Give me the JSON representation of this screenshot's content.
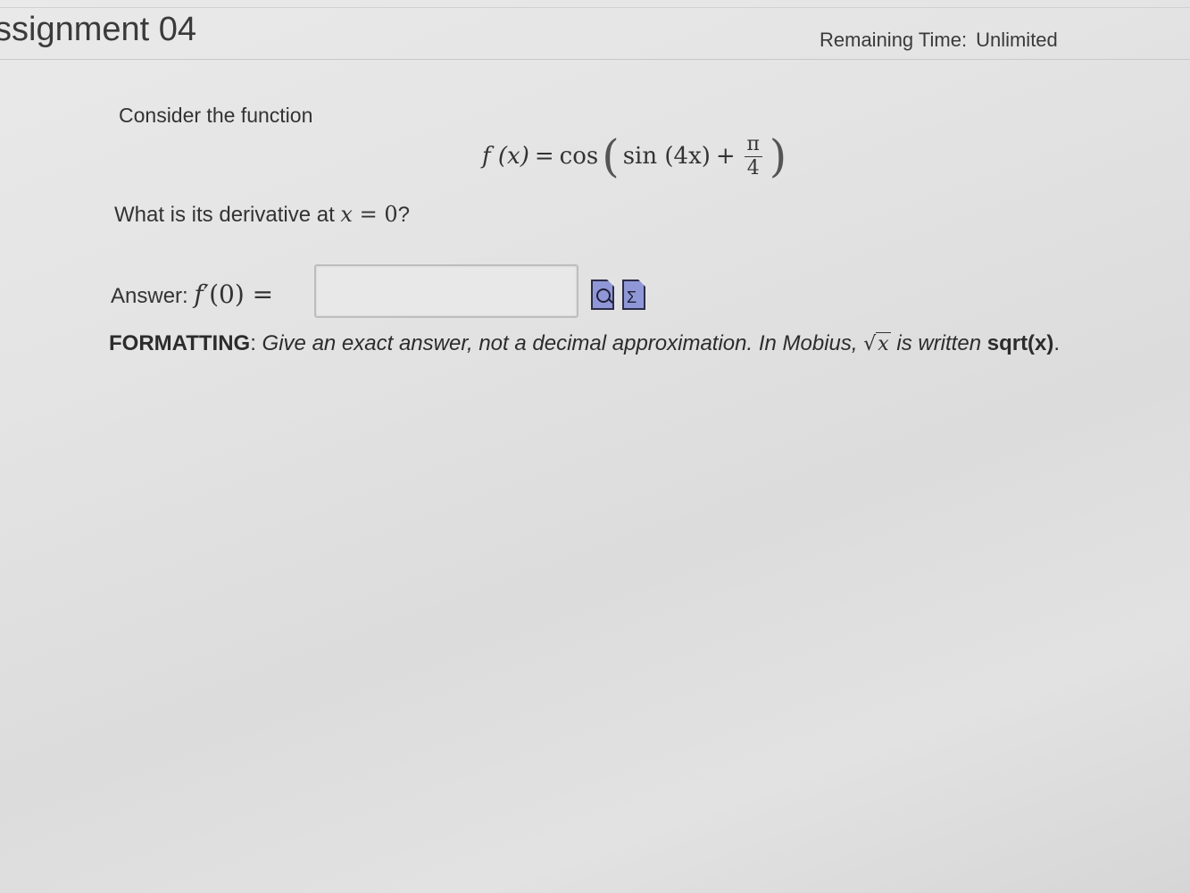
{
  "header": {
    "assignment_title": "ssignment 04",
    "remaining_label": "Remaining Time:",
    "remaining_value": "Unlimited"
  },
  "question": {
    "intro": "Consider the function",
    "formula": {
      "lhs": "f (x)",
      "equals": "=",
      "cos": "cos",
      "open": "(",
      "sin": "sin (4x)",
      "plus": "+",
      "frac_num": "π",
      "frac_den": "4",
      "close": ")"
    },
    "prompt_text": "What is its derivative at ",
    "prompt_var": "x",
    "prompt_eq": " = ",
    "prompt_val": "0",
    "prompt_end": "?"
  },
  "answer": {
    "label": "Answer: ",
    "expr_f": "f",
    "expr_prime": "′",
    "expr_arg": "(0) =",
    "input_value": "",
    "icons": [
      "preview-icon",
      "equation-editor-icon"
    ],
    "equation_glyph": "Σ"
  },
  "formatting": {
    "label": "FORMATTING",
    "colon": ": ",
    "instruction": "Give an exact answer, not a decimal approximation.  In Mobius, ",
    "sqrt_var": "x",
    "written": " is written ",
    "code": "sqrt(x)",
    "end": "."
  }
}
